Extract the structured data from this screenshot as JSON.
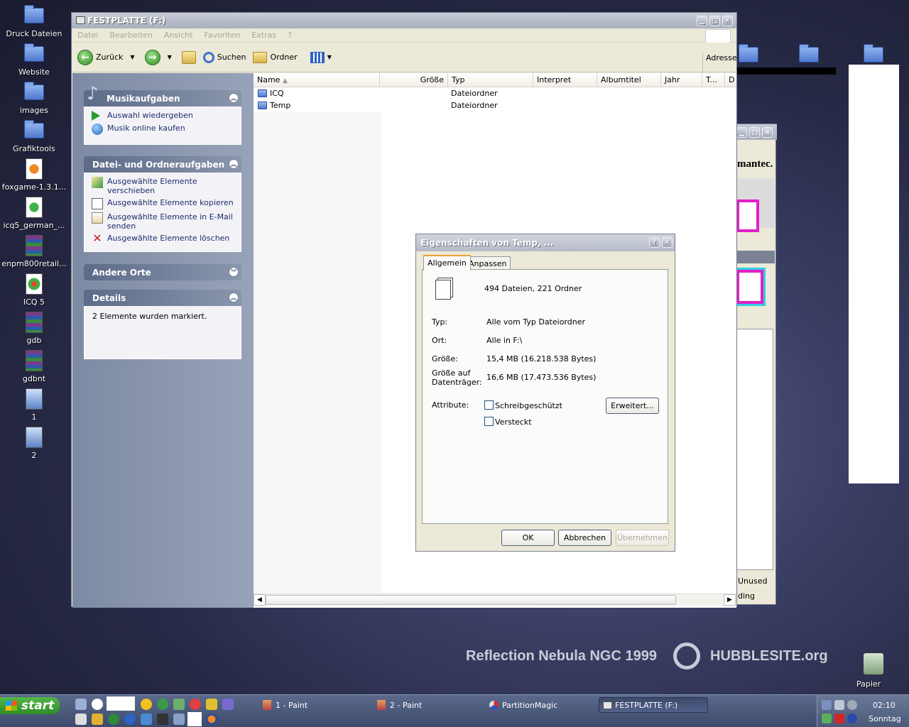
{
  "desktop": {
    "icons": [
      {
        "label": "Druck Dateien"
      },
      {
        "label": "Website"
      },
      {
        "label": "images"
      },
      {
        "label": "Grafiktools"
      },
      {
        "label": "foxgame-1.3.1..."
      },
      {
        "label": "icq5_german_..."
      },
      {
        "label": "enpm800retail..."
      },
      {
        "label": "ICQ 5"
      },
      {
        "label": "gdb"
      },
      {
        "label": "gdbnt"
      },
      {
        "label": "1"
      },
      {
        "label": "2"
      }
    ],
    "recycle_label": "Papier",
    "wallpaper_text": "Reflection Nebula NGC 1999",
    "wallpaper_brand": "HUBBLESITE.org"
  },
  "explorer": {
    "title": "FESTPLATTE (F:)",
    "menu": [
      "Datei",
      "Bearbeiten",
      "Ansicht",
      "Favoriten",
      "Extras",
      "?"
    ],
    "toolbar": {
      "back": "Zurück",
      "search": "Suchen",
      "folders": "Ordner",
      "address": "Adresse"
    },
    "tasks": {
      "music_title": "Musikaufgaben",
      "music_items": [
        "Auswahl wiedergeben",
        "Musik online kaufen"
      ],
      "file_title": "Datei- und Ordneraufgaben",
      "file_items": [
        "Ausgewählte Elemente verschieben",
        "Ausgewählte Elemente kopieren",
        "Ausgewählte Elemente in E-Mail senden",
        "Ausgewählte Elemente löschen"
      ],
      "other_title": "Andere Orte",
      "details_title": "Details",
      "details_text": "2 Elemente wurden markiert."
    },
    "columns": [
      "Name",
      "Größe",
      "Typ",
      "Interpret",
      "Albumtitel",
      "Jahr",
      "T...",
      "D"
    ],
    "rows": [
      {
        "name": "ICQ",
        "type": "Dateiordner"
      },
      {
        "name": "Temp",
        "type": "Dateiordner"
      }
    ]
  },
  "bg_window": {
    "brand_fragment": "mantec.",
    "unused": "Unused",
    "ding": "ding"
  },
  "dialog": {
    "title": "Eigenschaften von Temp, ...",
    "tabs": [
      "Allgemein",
      "Anpassen"
    ],
    "summary": "494 Dateien, 221 Ordner",
    "typ_label": "Typ:",
    "typ_value": "Alle vom Typ Dateiordner",
    "ort_label": "Ort:",
    "ort_value": "Alle in F:\\",
    "size_label": "Größe:",
    "size_value": "15,4 MB (16.218.538 Bytes)",
    "disk_label_1": "Größe auf",
    "disk_label_2": "Datenträger:",
    "disk_value": "16,6 MB (17.473.536 Bytes)",
    "attr_label": "Attribute:",
    "readonly": "Schreibgeschützt",
    "hidden": "Versteckt",
    "advanced": "Erweitert...",
    "ok": "OK",
    "cancel": "Abbrechen",
    "apply": "Übernehmen"
  },
  "taskbar": {
    "start": "start",
    "tasks": [
      "1 - Paint",
      "2 - Paint",
      "PartitionMagic",
      "FESTPLATTE (F:)"
    ],
    "clock": "02:10",
    "day": "Sonntag"
  }
}
